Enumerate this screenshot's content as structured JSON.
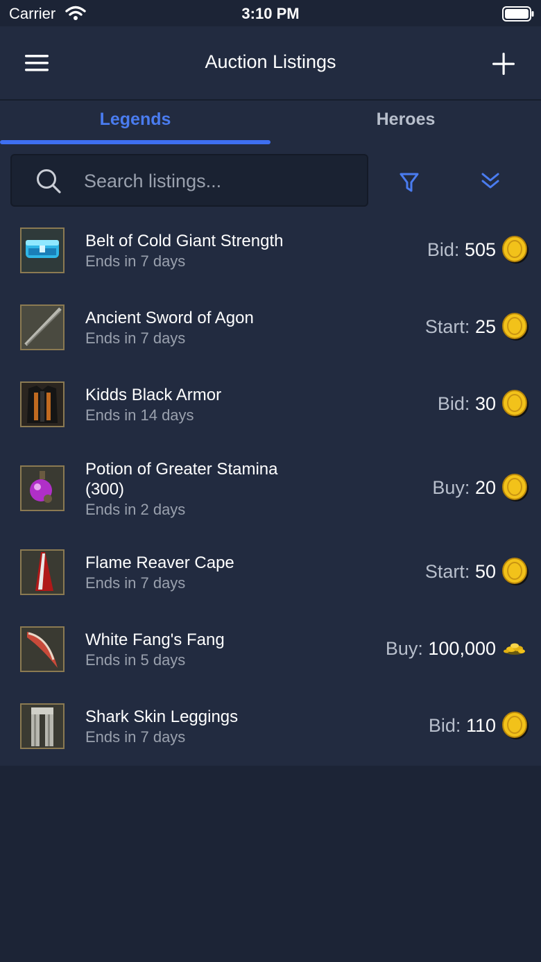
{
  "status_bar": {
    "carrier": "Carrier",
    "time": "3:10 PM",
    "icons": [
      "wifi-icon",
      "battery-icon"
    ]
  },
  "nav": {
    "title": "Auction Listings",
    "left_icon": "menu-icon",
    "right_icon": "add-icon"
  },
  "tabs": [
    {
      "label": "Legends",
      "active": true
    },
    {
      "label": "Heroes",
      "active": false
    }
  ],
  "search": {
    "placeholder": "Search listings...",
    "value": "",
    "icons": [
      "search-icon",
      "filter-icon",
      "sort-icon"
    ]
  },
  "colors": {
    "background": "#1c2436",
    "panel": "#222b40",
    "accent": "#3e6ff1",
    "secondary_text": "#9aa1ae",
    "coin": "#f2c21a"
  },
  "listings": [
    {
      "name": "Belt of Cold Giant Strength",
      "ends": "Ends in 7 days",
      "price_type": "Bid:",
      "price": "505",
      "currency_icon": "gold-coin-icon",
      "thumb_icon": "belt-icon"
    },
    {
      "name": "Ancient Sword of Agon",
      "ends": "Ends in 7 days",
      "price_type": "Start:",
      "price": "25",
      "currency_icon": "gold-coin-icon",
      "thumb_icon": "sword-icon"
    },
    {
      "name": "Kidds Black Armor",
      "ends": "Ends in 14 days",
      "price_type": "Bid:",
      "price": "30",
      "currency_icon": "gold-coin-icon",
      "thumb_icon": "armor-icon"
    },
    {
      "name": "Potion of Greater Stamina (300)",
      "ends": "Ends in 2 days",
      "price_type": "Buy:",
      "price": "20",
      "currency_icon": "gold-coin-icon",
      "thumb_icon": "potion-icon"
    },
    {
      "name": "Flame Reaver Cape",
      "ends": "Ends in 7 days",
      "price_type": "Start:",
      "price": "50",
      "currency_icon": "gold-coin-icon",
      "thumb_icon": "cape-icon"
    },
    {
      "name": "White Fang's Fang",
      "ends": "Ends in 5 days",
      "price_type": "Buy:",
      "price": "100,000",
      "currency_icon": "gold-pile-icon",
      "thumb_icon": "fang-icon"
    },
    {
      "name": "Shark Skin Leggings",
      "ends": "Ends in 7 days",
      "price_type": "Bid:",
      "price": "110",
      "currency_icon": "gold-coin-icon",
      "thumb_icon": "leggings-icon"
    }
  ]
}
